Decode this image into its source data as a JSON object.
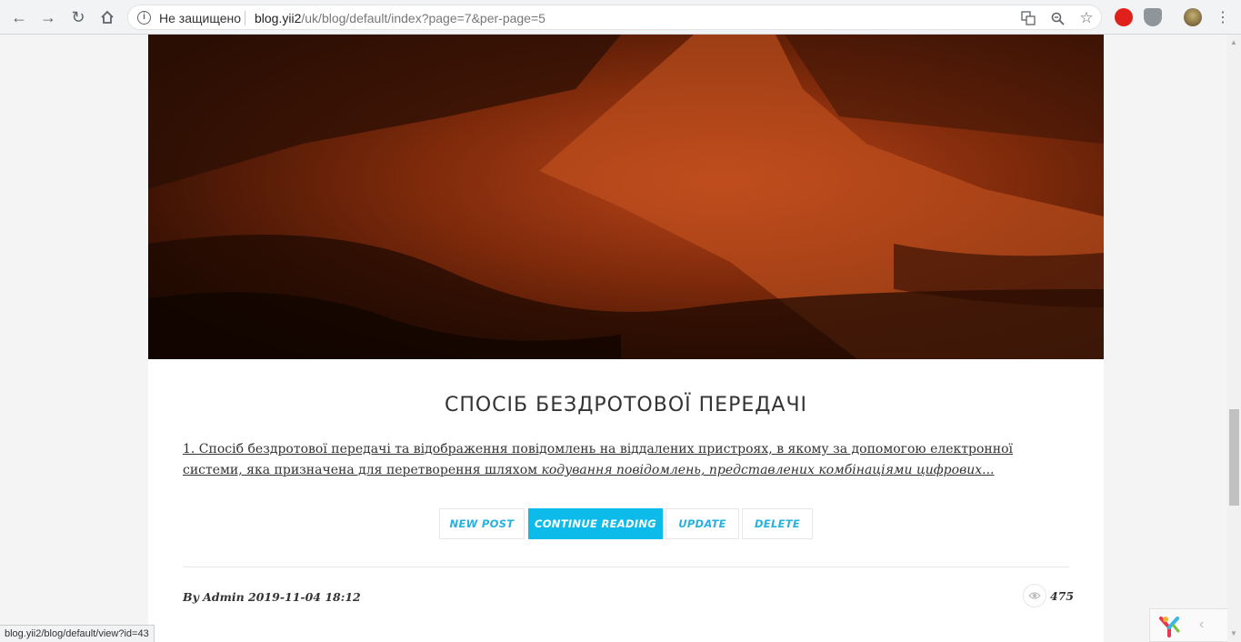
{
  "browser": {
    "security_label": "Не защищено",
    "url_host": "blog.yii2",
    "url_path": "/uk/blog/default/index?page=7&per-page=5",
    "status_url": "blog.yii2/blog/default/view?id=43"
  },
  "post": {
    "title": "СПОСІБ БЕЗДРОТОВОЇ ПЕРЕДАЧІ",
    "excerpt_plain": "1. Спосіб бездротової передачі та відображення повідомлень на віддалених пристроях, в якому за допомогою електронної системи, яка призначена для перетворення шляхом ",
    "excerpt_italic": "кодування повідомлень, представлених комбінаціями цифрових...",
    "meta": "By Admin 2019-11-04 18:12",
    "views": "475"
  },
  "actions": {
    "new_post": "NEW POST",
    "continue_reading": "CONTINUE READING",
    "update": "UPDATE",
    "delete": "DELETE"
  },
  "colors": {
    "accent": "#0cbbea",
    "link": "#27b1e0"
  }
}
